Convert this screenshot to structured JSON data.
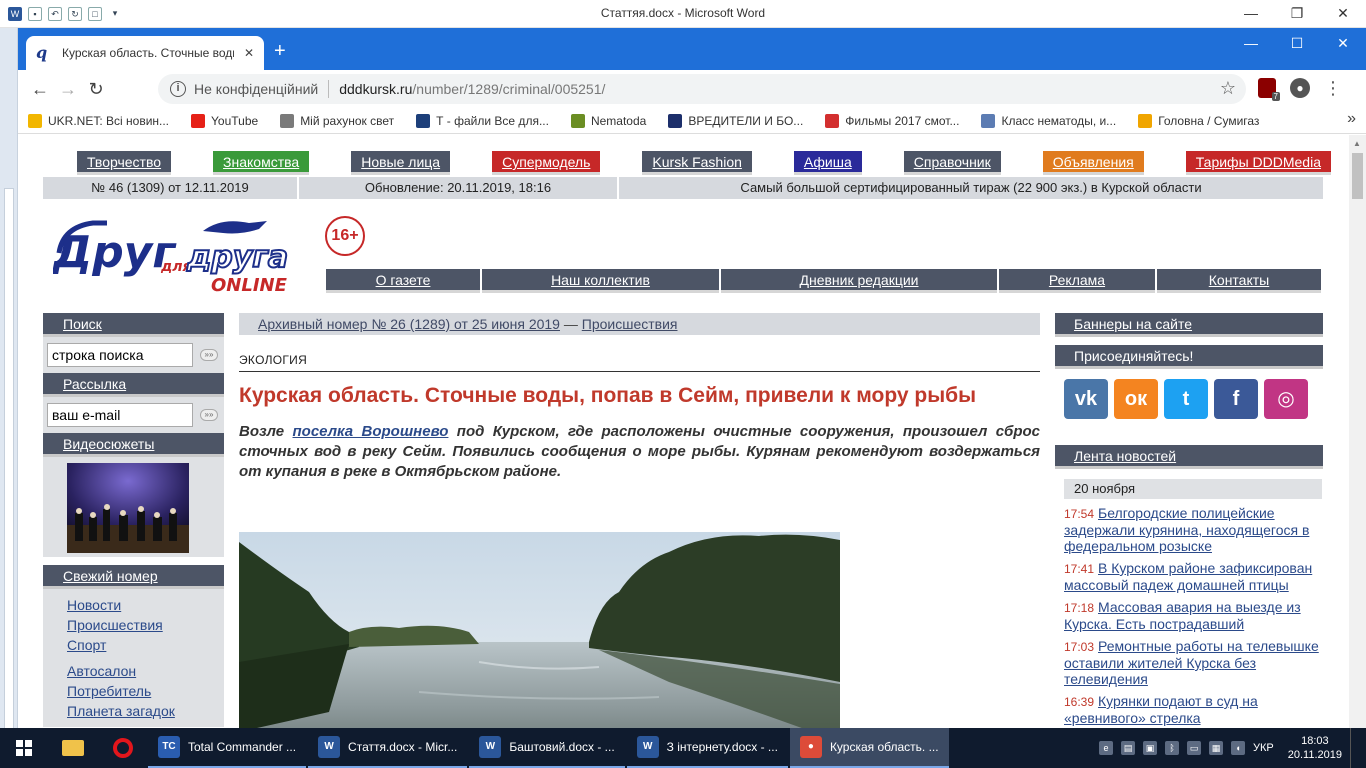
{
  "word": {
    "title": "Статтяя.docx - Microsoft Word"
  },
  "chrome": {
    "tab_title": "Курская область. Сточные воды",
    "url_nc": "Не конфіденційний",
    "url_host": "dddkursk.ru",
    "url_path": "/number/1289/criminal/005251/"
  },
  "bookmarks": [
    {
      "label": "UKR.NET: Всі новин...",
      "icon": "ukrnet-icon",
      "color": "#f2b600"
    },
    {
      "label": "YouTube",
      "icon": "youtube-icon",
      "color": "#e62117"
    },
    {
      "label": "Мій рахунок свет",
      "icon": "globe-icon",
      "color": "#7a7a7a"
    },
    {
      "label": "Т - файли Все для...",
      "icon": "t-files-icon",
      "color": "#1d3f7a"
    },
    {
      "label": "Nematoda",
      "icon": "nematoda-icon",
      "color": "#6b8e23"
    },
    {
      "label": "ВРЕДИТЕЛИ И БО...",
      "icon": "d-icon",
      "color": "#1d2f6b"
    },
    {
      "label": "Фильмы 2017 смот...",
      "icon": "ki-icon",
      "color": "#d32f2f"
    },
    {
      "label": "Класс нематоды, и...",
      "icon": "shield-icon",
      "color": "#5c7cb3"
    },
    {
      "label": "Головна / Сумигаз",
      "icon": "sumigaz-icon",
      "color": "#f0a500"
    }
  ],
  "site": {
    "topnav": [
      {
        "label": "Творчество",
        "color": "#4d5566"
      },
      {
        "label": "Знакомства",
        "color": "#3a9a3a"
      },
      {
        "label": "Новые лица",
        "color": "#4d5566"
      },
      {
        "label": "Супермодель",
        "color": "#c62828"
      },
      {
        "label": "Kursk Fashion",
        "color": "#4d5566"
      },
      {
        "label": "Афиша",
        "color": "#2a2a9a"
      },
      {
        "label": "Справочник",
        "color": "#4d5566"
      },
      {
        "label": "Объявления",
        "color": "#e07b1e"
      },
      {
        "label": "Тарифы DDDMedia",
        "color": "#c62828"
      }
    ],
    "issue": "№ 46 (1309) от 12.11.2019",
    "updated": "Обновление: 20.11.2019, 18:16",
    "circulation": "Самый большой сертифицированный тираж (22 900 экз.) в Курской области",
    "age": "16+",
    "logo_main": "Друг",
    "logo_for": "для",
    "logo_friend": "друга",
    "logo_online": "ONLINE",
    "subnav": [
      "О газете",
      "Наш коллектив",
      "Дневник редакции",
      "Реклама",
      "Контакты"
    ],
    "left": {
      "search_title": "Поиск",
      "search_value": "строка поиска",
      "mail_title": "Рассылка",
      "mail_value": "ваш e-mail",
      "video_title": "Видеосюжеты",
      "fresh_title": "Свежий номер",
      "fresh_items": [
        "Новости",
        "Происшествия",
        "Спорт"
      ],
      "fresh_items2": [
        "Автосалон",
        "Потребитель",
        "Планета загадок"
      ]
    },
    "center": {
      "crumb_archive": "Архивный номер № 26 (1289) от 25 июня 2019",
      "crumb_sep": " — ",
      "crumb_section": "Происшествия",
      "rubric": "ЭКОЛОГИЯ",
      "headline": "Курская область. Сточные воды, попав в Сейм, привели к мору рыбы",
      "lead_pre": "Возле ",
      "lead_link": "поселка Ворошнево",
      "lead_post": " под Курском, где расположены очистные сооружения, произошел сброс сточных вод в реку Сейм. Появились сообщения о море рыбы. Курянам рекомендуют воздержаться от купания в реке в Октябрьском районе."
    },
    "right": {
      "banners": "Баннеры на сайте",
      "join": "Присоединяйтесь!",
      "social": [
        {
          "name": "vk-icon",
          "glyph": "vk",
          "color": "#4a76a8"
        },
        {
          "name": "odnoklassniki-icon",
          "glyph": "ок",
          "color": "#f48420"
        },
        {
          "name": "twitter-icon",
          "glyph": "t",
          "color": "#1da1f2"
        },
        {
          "name": "facebook-icon",
          "glyph": "f",
          "color": "#3b5998"
        },
        {
          "name": "instagram-icon",
          "glyph": "◎",
          "color": "#c13584"
        }
      ],
      "feed_title": "Лента новостей",
      "date": "20 ноября",
      "news": [
        {
          "time": "17:54",
          "text": "Белгородские полицейские задержали курянина, находящегося в федеральном розыске"
        },
        {
          "time": "17:41",
          "text": "В Курском районе зафиксирован массовый падеж домашней птицы"
        },
        {
          "time": "17:18",
          "text": "Массовая авария на выезде из Курска. Есть пострадавший"
        },
        {
          "time": "17:03",
          "text": "Ремонтные работы на телевышке оставили жителей Курска без телевидения"
        },
        {
          "time": "16:39",
          "text": "Курянки подают в суд на «ревнивого» стрелка"
        }
      ]
    }
  },
  "taskbar": {
    "apps": [
      {
        "label": "Total Commander ...",
        "icon": "total-commander-icon",
        "color": "#2a5db0",
        "glyph": "TC"
      },
      {
        "label": "Стаття.docx - Micr...",
        "icon": "word-icon",
        "color": "#2b579a",
        "glyph": "W"
      },
      {
        "label": "Баштовий.docx - ...",
        "icon": "word-icon",
        "color": "#2b579a",
        "glyph": "W"
      },
      {
        "label": "З інтернету.docx - ...",
        "icon": "word-icon",
        "color": "#2b579a",
        "glyph": "W"
      },
      {
        "label": "Курская область. ...",
        "icon": "chrome-icon",
        "color": "#dd4b39",
        "glyph": "●"
      }
    ],
    "lang": "УКР",
    "time": "18:03",
    "date": "20.11.2019"
  }
}
